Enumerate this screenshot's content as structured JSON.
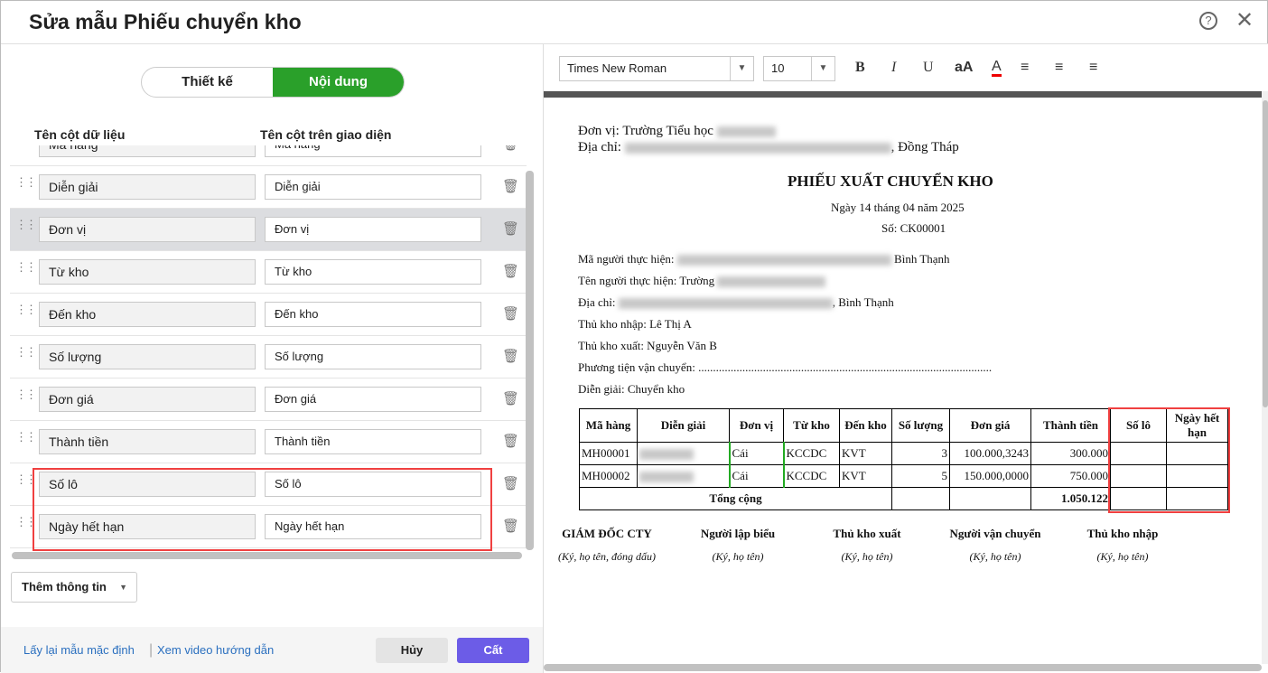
{
  "title": "Sửa mẫu Phiếu chuyển kho",
  "tabs": [
    "Thiết kế",
    "Nội dung"
  ],
  "col_headers": {
    "data": "Tên cột dữ liệu",
    "display": "Tên cột trên giao diện"
  },
  "rows": [
    {
      "a": "Mã hàng",
      "b": "Mã hàng"
    },
    {
      "a": "Diễn giải",
      "b": "Diễn giải"
    },
    {
      "a": "Đơn vị",
      "b": "Đơn vị"
    },
    {
      "a": "Từ kho",
      "b": "Từ kho"
    },
    {
      "a": "Đến kho",
      "b": "Đến kho"
    },
    {
      "a": "Số lượng",
      "b": "Số lượng"
    },
    {
      "a": "Đơn giá",
      "b": "Đơn giá"
    },
    {
      "a": "Thành tiền",
      "b": "Thành tiền"
    },
    {
      "a": "Số lô",
      "b": "Số lô"
    },
    {
      "a": "Ngày hết hạn",
      "b": "Ngày hết hạn"
    }
  ],
  "add_label": "Thêm thông tin",
  "footer": {
    "reset": "Lấy lại mẫu mặc định",
    "video": "Xem video hướng dẫn",
    "cancel": "Hủy",
    "save": "Cất"
  },
  "toolbar": {
    "font": "Times New Roman",
    "size": "10",
    "bold": "B",
    "italic": "I",
    "underline": "U",
    "case": "aA",
    "color": "A"
  },
  "doc": {
    "unit": "Đơn vị: Trường Tiểu học",
    "addr_label": "Địa chỉ:",
    "addr_tail": ", Đồng Tháp",
    "title": "PHIẾU XUẤT CHUYỂN KHO",
    "date": "Ngày 14 tháng 04 năm 2025",
    "number": "Số: CK00001",
    "f1": "Mã người thực hiện:",
    "f1t": "Bình Thạnh",
    "f2": "Tên người thực hiện: Trường",
    "f3": "Địa chỉ:",
    "f3t": ", Bình Thạnh",
    "f4": "Thủ kho nhập: Lê Thị A",
    "f5": "Thủ kho xuất: Nguyễn Văn B",
    "f6": "Phương tiện vận chuyển: ....................................................................................................",
    "f7": "Diễn giải: Chuyển kho",
    "headers": [
      "Mã hàng",
      "Diễn giải",
      "Đơn vị",
      "Từ kho",
      "Đến kho",
      "Số lượng",
      "Đơn giá",
      "Thành tiền",
      "Số lô",
      "Ngày hết hạn"
    ],
    "lines": [
      {
        "code": "MH00001",
        "unit": "Cái",
        "from": "KCCDC",
        "to": "KVT",
        "qty": "3",
        "price": "100.000,3243",
        "amount": "300.000"
      },
      {
        "code": "MH00002",
        "unit": "Cái",
        "from": "KCCDC",
        "to": "KVT",
        "qty": "5",
        "price": "150.000,0000",
        "amount": "750.000"
      }
    ],
    "total_label": "Tổng cộng",
    "total": "1.050.122",
    "signers": [
      "GIÁM ĐỐC CTY",
      "Người lập biểu",
      "Thủ kho xuất",
      "Người vận chuyển",
      "Thủ kho nhập"
    ],
    "sign_notes": [
      "(Ký, họ tên, đóng dấu)",
      "(Ký, họ tên)",
      "(Ký, họ tên)",
      "(Ký, họ tên)",
      "(Ký, họ tên)"
    ]
  },
  "colors": {
    "accent": "#2aa02a",
    "primary": "#6c5ce7",
    "highlight": "#f04040"
  }
}
